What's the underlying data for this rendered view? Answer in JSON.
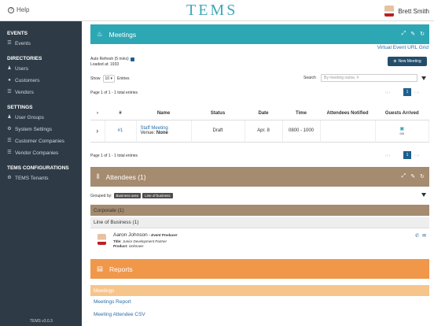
{
  "topbar": {
    "help": "Help",
    "logo": "TEMS",
    "user_name": "Brett Smith"
  },
  "sidebar": {
    "sections": [
      {
        "title": "EVENTS",
        "items": [
          {
            "label": "Events",
            "icon": "list-icon"
          }
        ]
      },
      {
        "title": "DIRECTORIES",
        "items": [
          {
            "label": "Users",
            "icon": "person-icon"
          },
          {
            "label": "Customers",
            "icon": "customer-icon"
          },
          {
            "label": "Vendors",
            "icon": "list-icon"
          }
        ]
      },
      {
        "title": "SETTINGS",
        "items": [
          {
            "label": "User Groups",
            "icon": "users-icon"
          },
          {
            "label": "System Settings",
            "icon": "gear-icon"
          },
          {
            "label": "Customer Companies",
            "icon": "list-icon"
          },
          {
            "label": "Vendor Companies",
            "icon": "list-icon"
          }
        ]
      },
      {
        "title": "TEMS CONFIGURATIONS",
        "items": [
          {
            "label": "TEMS Tenants",
            "icon": "gear-icon"
          }
        ]
      }
    ],
    "version": "TEMS v3.0.3"
  },
  "meetings": {
    "title": "Meetings",
    "virtual_link": "Virtual Event URL Grid",
    "new_button": "New Meeting",
    "auto_refresh": "Auto Refresh (5 mins)",
    "loaded_at": "Loaded at: 1933",
    "show": "Show",
    "entries_value": "10",
    "entries": "Entries",
    "search_label": "Search",
    "search_placeholder": "By meeting name, #",
    "page_info": "Page 1 of 1 - 1 total entries",
    "page_num": "1",
    "columns": [
      "#",
      "Name",
      "Status",
      "Date",
      "Time",
      "Attendees Notified",
      "Guests Arrived"
    ],
    "row": {
      "num": "#1",
      "name": "Staff Meeting",
      "venue_label": "Venue:",
      "venue": "None",
      "status": "Draft",
      "date": "Apr. 8",
      "time": "0800 - 1000",
      "guests": "0/0"
    },
    "page_info_bottom": "Page 1 of 1 - 1 total entries"
  },
  "attendees": {
    "title": "Attendees (1)",
    "grouped_by": "Grouped by:",
    "groups": [
      "Business area",
      "Line of business"
    ],
    "corporate": "Corporate (1)",
    "lob": "Line of Business (1)",
    "person": {
      "name": "Aaron Johnson",
      "role": "- Event Producer",
      "title_label": "Title:",
      "title": "Junior Development Partner",
      "product_label": "Product:",
      "product": "Unknown"
    }
  },
  "reports": {
    "title": "Reports",
    "band": "Meetings",
    "links": [
      "Meetings Report",
      "Meeting Attendee CSV"
    ]
  },
  "colors": {
    "teal": "#2ea7b4",
    "brown": "#a58b6f",
    "orange": "#f0974a",
    "sidebar": "#2e3b47",
    "primary": "#1e5f8c"
  }
}
